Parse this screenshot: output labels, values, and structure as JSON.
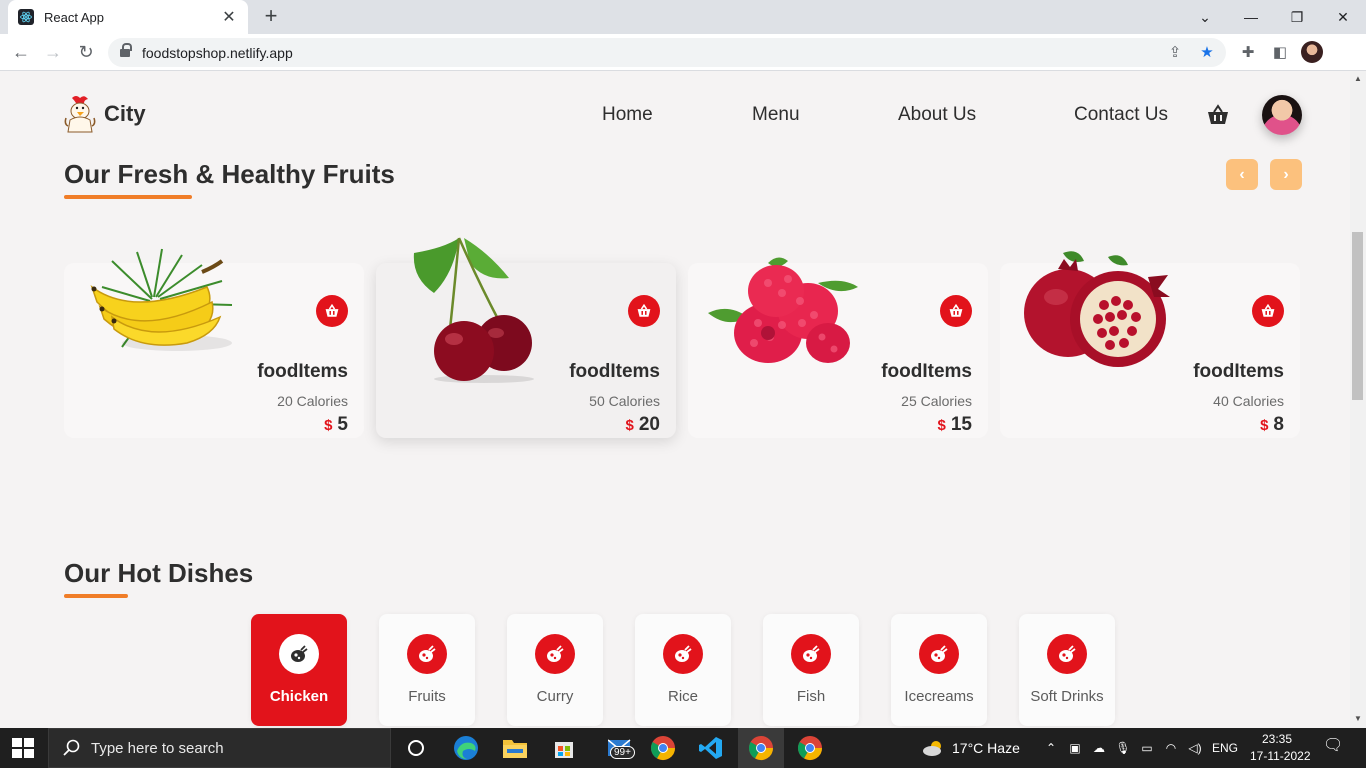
{
  "browser": {
    "tab_title": "React App",
    "url": "foodstopshop.netlify.app",
    "new_tab_label": "+",
    "close_label": "✕"
  },
  "site": {
    "brand": "City",
    "nav": [
      "Home",
      "Menu",
      "About Us",
      "Contact Us"
    ]
  },
  "fruits_section": {
    "title": "Our Fresh & Healthy Fruits",
    "prev_label": "‹",
    "next_label": "›",
    "currency": "$",
    "cards": [
      {
        "name": "foodItems",
        "calories": "20 Calories",
        "price": "5",
        "image": "banana"
      },
      {
        "name": "foodItems",
        "calories": "50 Calories",
        "price": "20",
        "image": "cherry"
      },
      {
        "name": "foodItems",
        "calories": "25 Calories",
        "price": "15",
        "image": "raspberry"
      },
      {
        "name": "foodItems",
        "calories": "40 Calories",
        "price": "8",
        "image": "pomegranate"
      }
    ]
  },
  "dishes_section": {
    "title": "Our Hot Dishes",
    "categories": [
      {
        "label": "Chicken",
        "active": true
      },
      {
        "label": "Fruits",
        "active": false
      },
      {
        "label": "Curry",
        "active": false
      },
      {
        "label": "Rice",
        "active": false
      },
      {
        "label": "Fish",
        "active": false
      },
      {
        "label": "Icecreams",
        "active": false
      },
      {
        "label": "Soft Drinks",
        "active": false
      }
    ]
  },
  "taskbar": {
    "search_placeholder": "Type here to search",
    "mail_badge": "99+",
    "weather": "17°C  Haze",
    "language": "ENG",
    "time": "23:35",
    "date": "17-11-2022"
  },
  "colors": {
    "accent_red": "#e2131b",
    "accent_orange": "#f07d28",
    "arrow_bg": "#fcc17d",
    "page_bg": "#f5f3f3"
  }
}
